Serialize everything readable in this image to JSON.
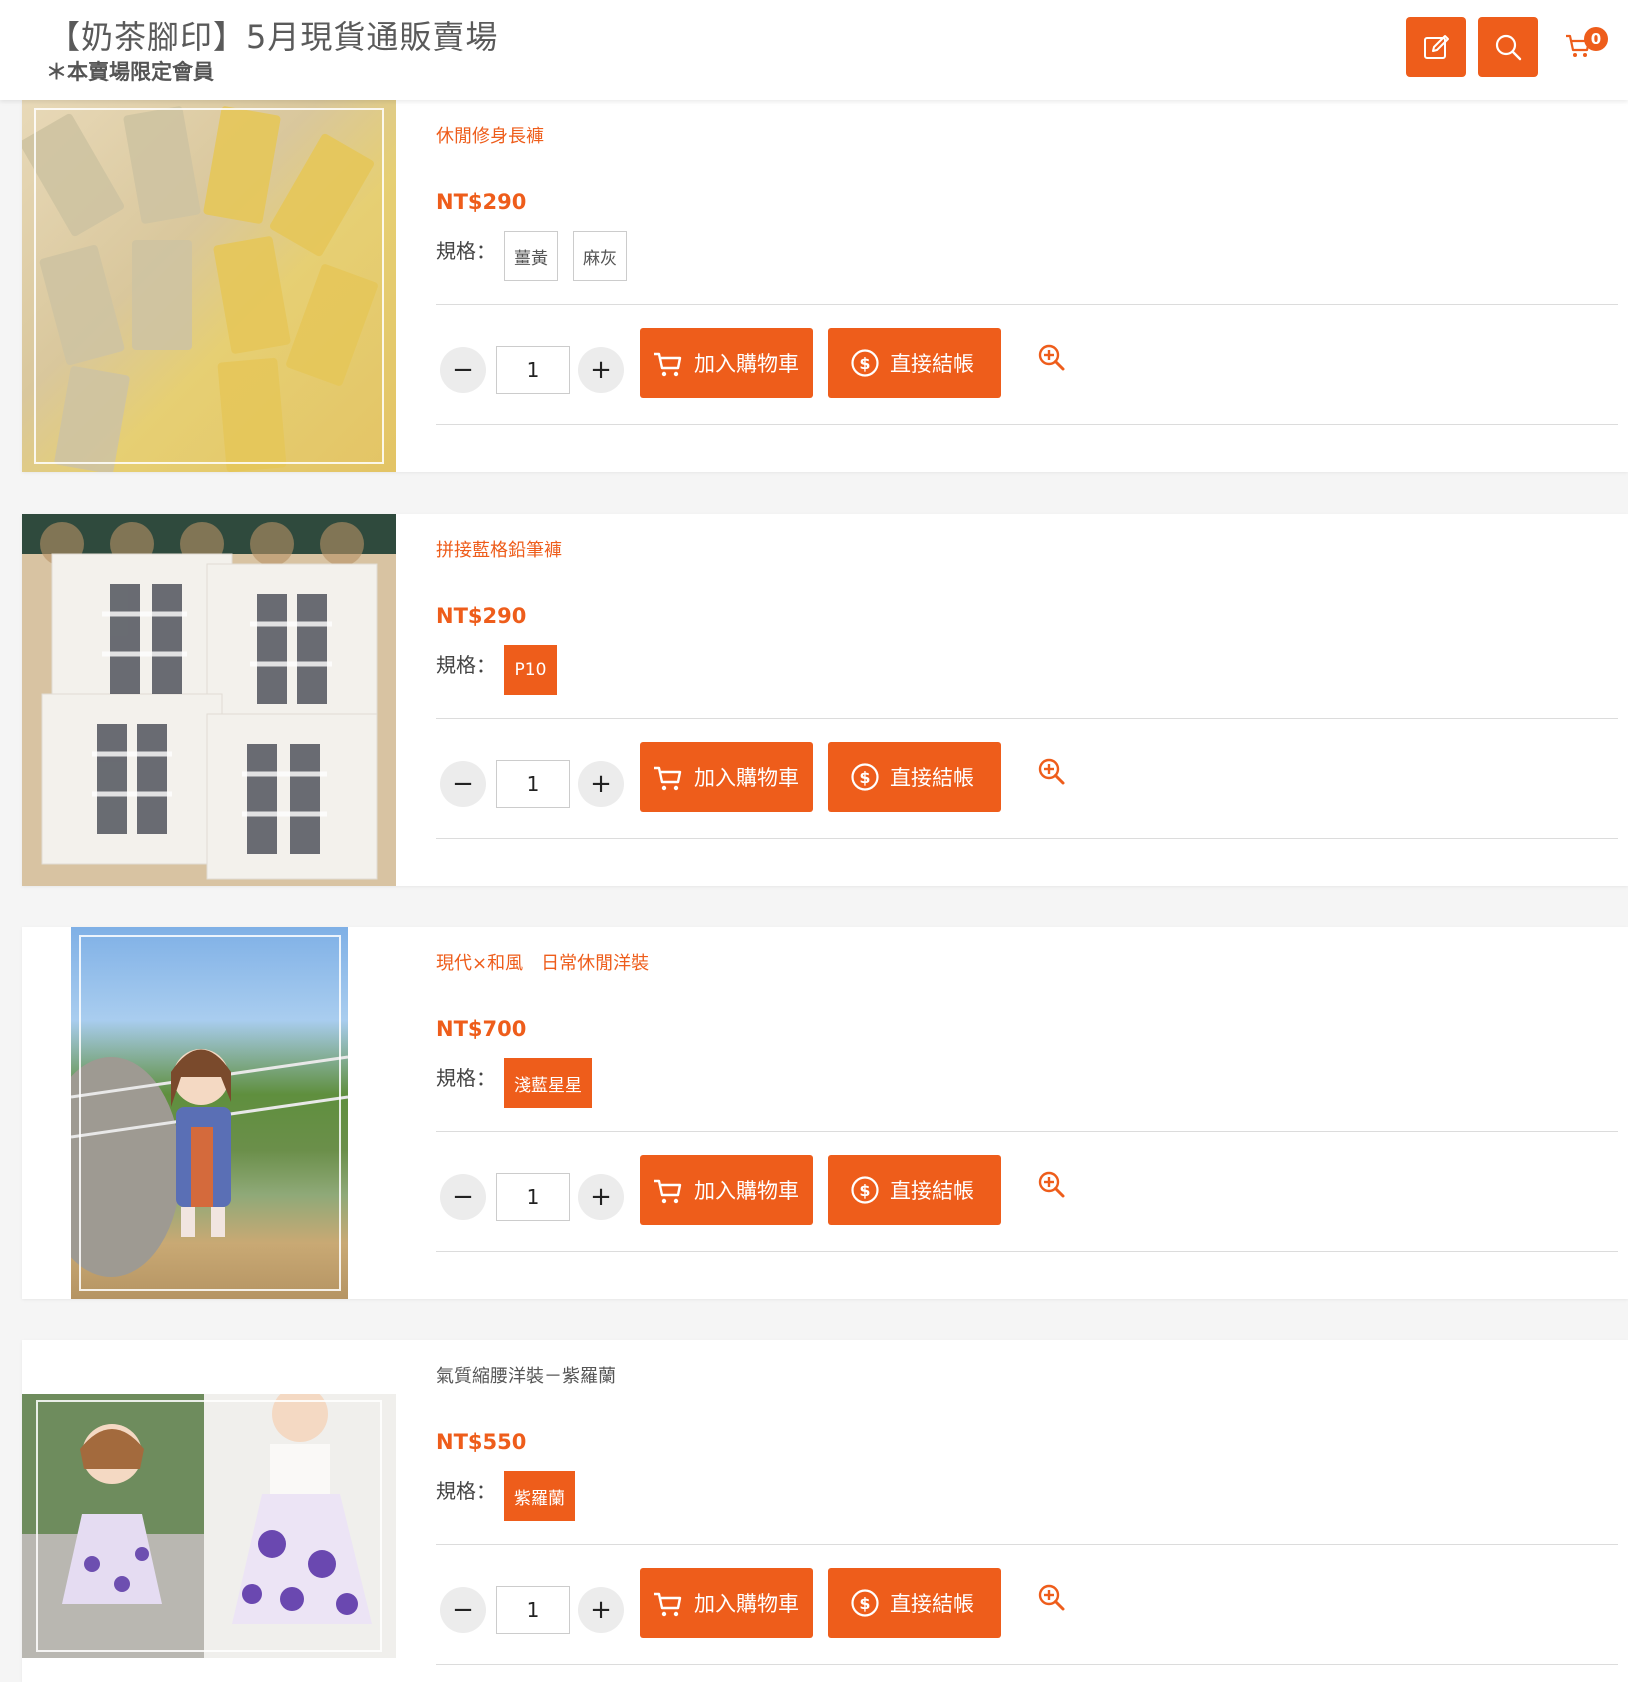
{
  "header": {
    "title": "【奶茶腳印】5月現貨通販賣場",
    "subtitle": "＊本賣場限定會員",
    "cart_count": "0",
    "icons": [
      "edit-icon",
      "search-icon",
      "cart-icon"
    ]
  },
  "ui": {
    "spec_label": "規格：",
    "add_to_cart": "加入購物車",
    "checkout": "直接結帳",
    "minus": "−",
    "plus": "+",
    "accent_color": "#ee5d1b"
  },
  "products": [
    {
      "name": "休閒修身長褲",
      "price": "NT$290",
      "quantity": "1",
      "options": [
        "薑黃",
        "麻灰"
      ],
      "selected": []
    },
    {
      "name": "拼接藍格鉛筆褲",
      "price": "NT$290",
      "quantity": "1",
      "options": [
        "P10"
      ],
      "selected": [
        "P10"
      ]
    },
    {
      "name": "現代×和風　日常休閒洋裝",
      "price": "NT$700",
      "quantity": "1",
      "options": [
        "淺藍星星"
      ],
      "selected": [
        "淺藍星星"
      ]
    },
    {
      "name": "氣質縮腰洋裝－紫羅蘭",
      "price": "NT$550",
      "quantity": "1",
      "options": [
        "紫羅蘭"
      ],
      "selected": [
        "紫羅蘭"
      ]
    }
  ]
}
